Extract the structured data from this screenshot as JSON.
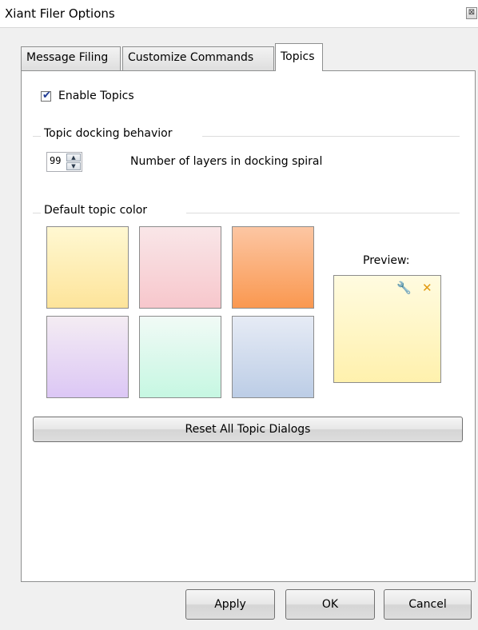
{
  "window": {
    "title": "Xiant Filer Options",
    "close_glyph": "⊠"
  },
  "tabs": [
    {
      "label": "Message Filing",
      "active": false
    },
    {
      "label": "Customize Commands",
      "active": false
    },
    {
      "label": "Topics",
      "active": true
    }
  ],
  "topics": {
    "enable_label": "Enable Topics",
    "enable_checked": true,
    "docking_group_label": "Topic docking behavior",
    "layers_value": "99",
    "layers_label": "Number of layers in docking spiral",
    "color_group_label": "Default topic color",
    "preview_label": "Preview:",
    "swatches": [
      {
        "name": "yellow",
        "top": "#fff8d2",
        "bottom": "#fde49a"
      },
      {
        "name": "pink",
        "top": "#f9e6e8",
        "bottom": "#f7c7cc"
      },
      {
        "name": "orange",
        "top": "#fcc6a3",
        "bottom": "#fa9850"
      },
      {
        "name": "lavender",
        "top": "#f4ecf3",
        "bottom": "#dcc7f5"
      },
      {
        "name": "mint",
        "top": "#f1faf6",
        "bottom": "#c6f7e2"
      },
      {
        "name": "blue",
        "top": "#e6ebf5",
        "bottom": "#bccde6"
      }
    ],
    "preview_icons": [
      "wrench-icon",
      "close-icon"
    ],
    "reset_button": "Reset All Topic Dialogs"
  },
  "buttons": {
    "apply": "Apply",
    "ok": "OK",
    "cancel": "Cancel"
  },
  "icons": {
    "wrench": "🔧",
    "close": "✕",
    "check": "✔",
    "up": "▲",
    "down": "▼"
  }
}
